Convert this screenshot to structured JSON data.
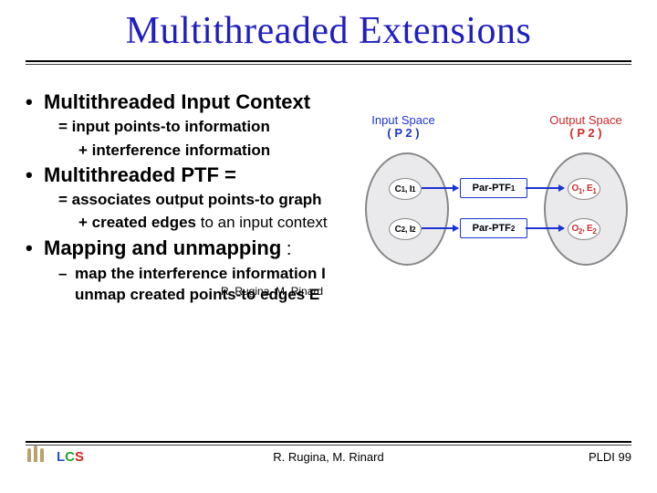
{
  "title": "Multithreaded Extensions",
  "bullets": {
    "b1": "Multithreaded Input Context",
    "b1_sub1": "= input points-to information",
    "b1_sub2": "+  interference information",
    "b2": "Multithreaded PTF =",
    "b2_sub1": "=  associates output points-to graph",
    "b2_sub2": "+ created edges",
    "b2_sub2_tail": " to an input context",
    "b3": "Mapping and unmapping",
    "b3_colon": " :",
    "b3_dash": "map the interference information I",
    "b3_dash2a": "unmap  created points-to edges E",
    "b3_dash2_overlay": "R. Rugina, M. Rinard"
  },
  "diagram": {
    "input_label": "Input Space",
    "input_label2": "( P 2 )",
    "output_label": "Output Space",
    "output_label2": "( P 2 )",
    "left_top": "C1, I1",
    "left_bot": "C2, I2",
    "right_top": "O1, E1",
    "right_bot": "O2, E2",
    "arrow_top": "Par-PTF1",
    "arrow_bot": "Par-PTF2",
    "sub1": "1",
    "sub2": "2"
  },
  "footer": {
    "center": "R. Rugina, M. Rinard",
    "right": "PLDI 99",
    "lcs_l": "L",
    "lcs_c": "C",
    "lcs_s": "S"
  }
}
